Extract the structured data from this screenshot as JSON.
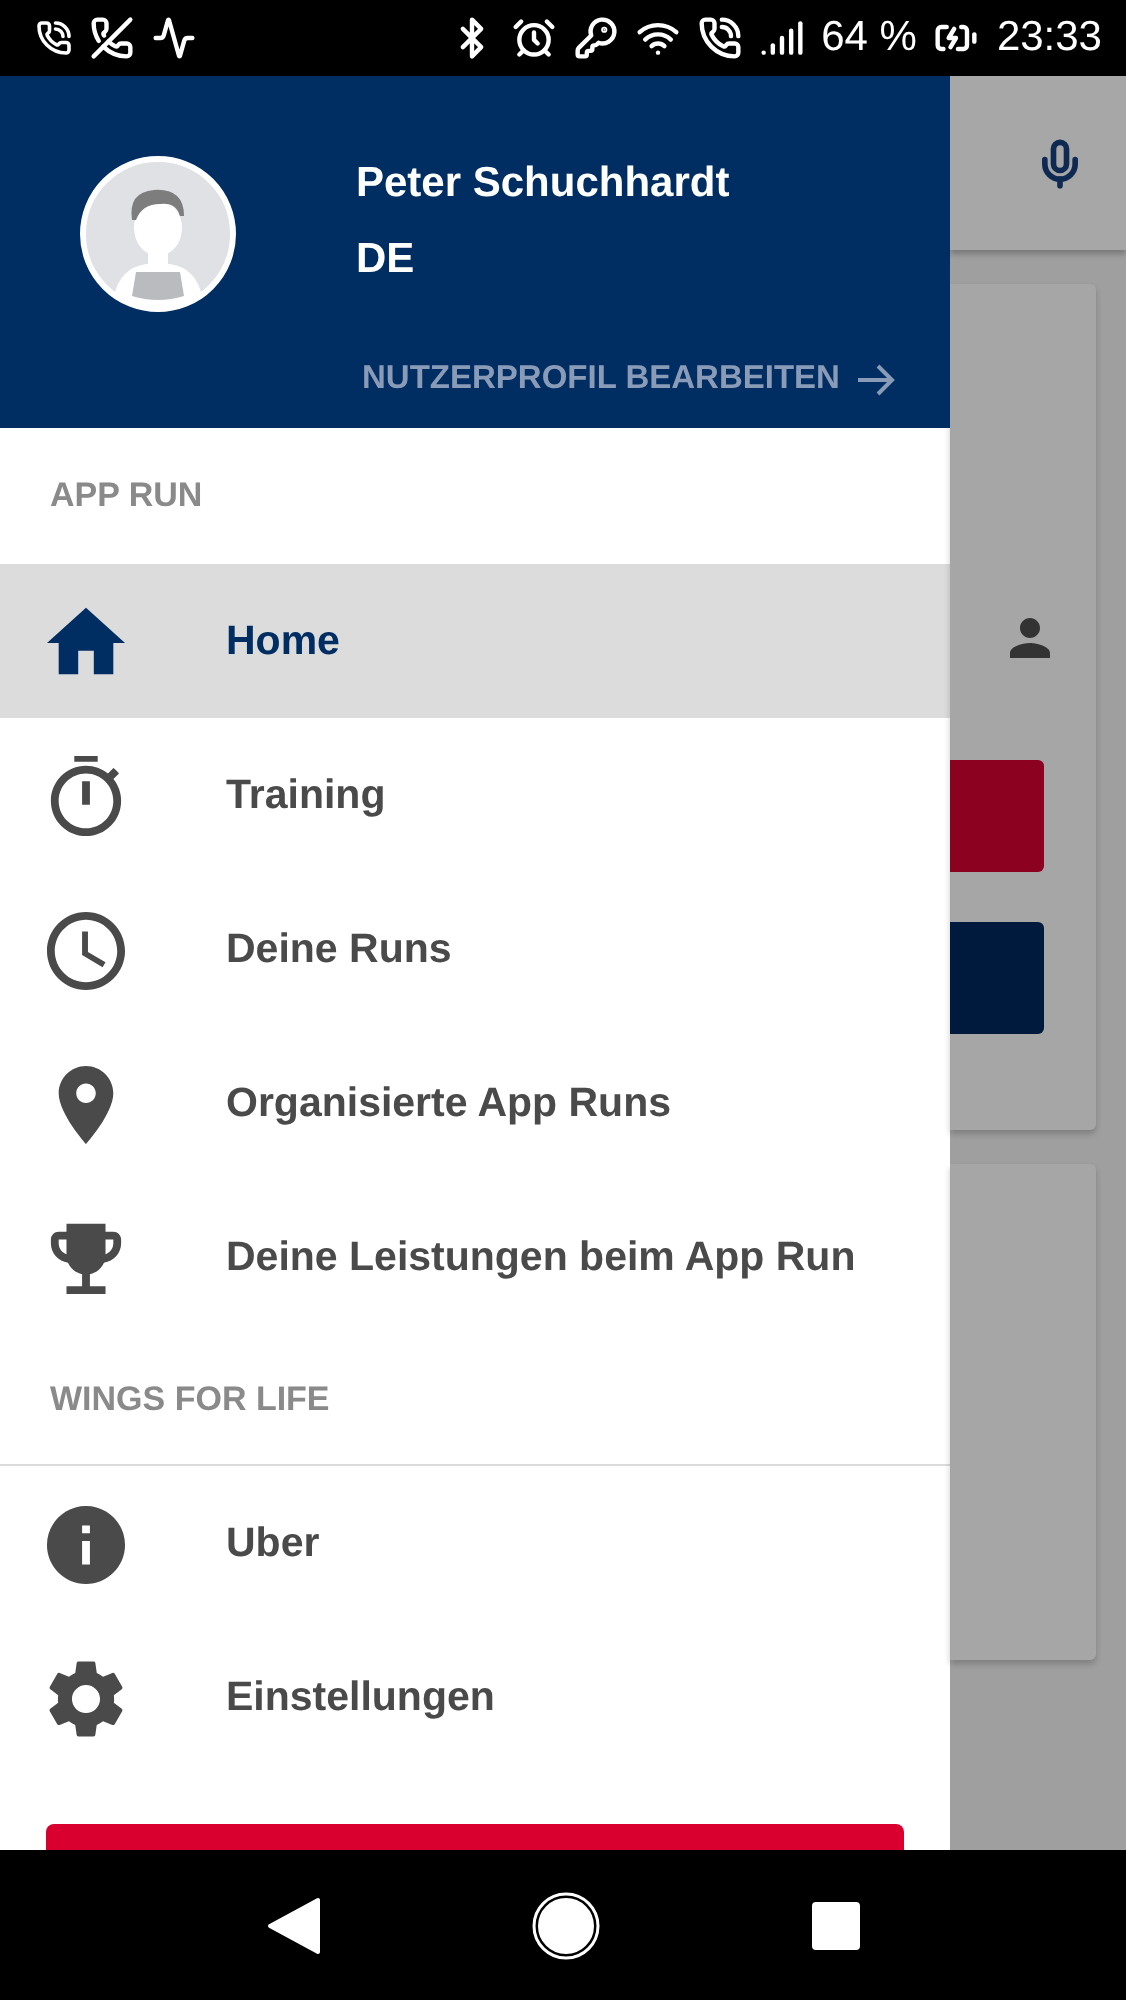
{
  "status_bar": {
    "battery": "64 %",
    "time": "23:33"
  },
  "profile": {
    "name": "Peter Schuchhardt",
    "country": "DE",
    "edit_link": "NUTZERPROFIL BEARBEITEN"
  },
  "sections": [
    {
      "title": "APP RUN",
      "divider": false,
      "items": [
        {
          "label": "Home",
          "kind": "home",
          "selected": true
        },
        {
          "label": "Training",
          "kind": "timer",
          "selected": false
        },
        {
          "label": "Deine Runs",
          "kind": "clock",
          "selected": false
        },
        {
          "label": "Organisierte App Runs",
          "kind": "pin",
          "selected": false
        },
        {
          "label": "Deine Leistungen beim App Run",
          "kind": "trophy",
          "selected": false
        }
      ]
    },
    {
      "title": "WINGS FOR LIFE",
      "divider": true,
      "items": [
        {
          "label": "Uber",
          "kind": "info",
          "selected": false
        },
        {
          "label": "Einstellungen",
          "kind": "gear",
          "selected": false
        }
      ]
    }
  ]
}
